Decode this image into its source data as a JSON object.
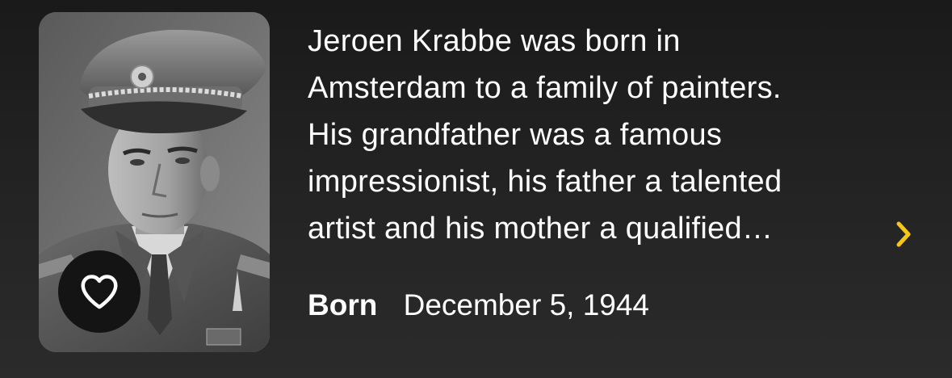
{
  "person": {
    "bio_lines": [
      "Jeroen Krabbe was born in",
      "Amsterdam to a family of painters.",
      "His grandfather was a famous",
      "impressionist, his father a talented",
      "artist and his mother a qualified…"
    ],
    "born_label": "Born",
    "born_value": "December 5, 1944"
  },
  "photo": {
    "subject": "black-and-white portrait of a man in a military peaked cap and uniform"
  },
  "icons": {
    "favorite": "heart-outline-icon",
    "more": "chevron-right-icon"
  },
  "colors": {
    "background": "#222222",
    "text": "#ffffff",
    "accent": "#f5c518",
    "favorite_button_bg": "#141414"
  }
}
